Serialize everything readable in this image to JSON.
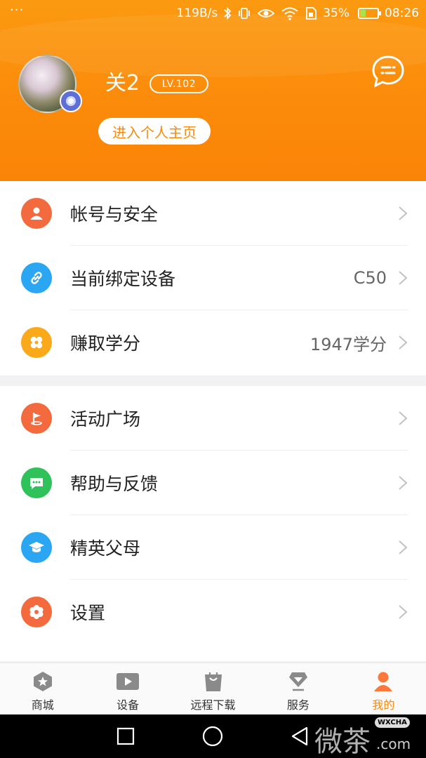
{
  "status_bar": {
    "menu_dots": "···",
    "network_speed": "119B/s",
    "battery_percent": "35%",
    "battery_level": 0.35,
    "time": "08:26"
  },
  "profile": {
    "username": "关2",
    "level": "LV.102",
    "profile_button": "进入个人主页"
  },
  "menu_group_1": [
    {
      "label": "帐号与安全",
      "value": "",
      "icon": "person-icon",
      "color": "#f26a3d"
    },
    {
      "label": "当前绑定设备",
      "value": "C50",
      "icon": "link-icon",
      "color": "#2aa6f2"
    },
    {
      "label": "赚取学分",
      "value": "1947学分",
      "icon": "clover-icon",
      "color": "#f9a91a"
    }
  ],
  "menu_group_2": [
    {
      "label": "活动广场",
      "value": "",
      "icon": "flag-icon",
      "color": "#f26a3d"
    },
    {
      "label": "帮助与反馈",
      "value": "",
      "icon": "chat-bubble-icon",
      "color": "#2fc15a"
    },
    {
      "label": "精英父母",
      "value": "",
      "icon": "graduation-cap-icon",
      "color": "#2aa6f2"
    },
    {
      "label": "设置",
      "value": "",
      "icon": "gear-icon",
      "color": "#f26a3d"
    }
  ],
  "bottom_nav": [
    {
      "label": "商城",
      "icon": "shop-icon",
      "active": false
    },
    {
      "label": "设备",
      "icon": "play-icon",
      "active": false
    },
    {
      "label": "远程下载",
      "icon": "bag-icon",
      "active": false
    },
    {
      "label": "服务",
      "icon": "diamond-icon",
      "active": false
    },
    {
      "label": "我的",
      "icon": "user-icon",
      "active": true
    }
  ],
  "watermark": {
    "cn": "微茶",
    "tag": "WXCHA",
    "en": ".com"
  },
  "colors": {
    "accent": "#fb8a0a",
    "header_top": "#fb9a10",
    "text": "#222222"
  }
}
